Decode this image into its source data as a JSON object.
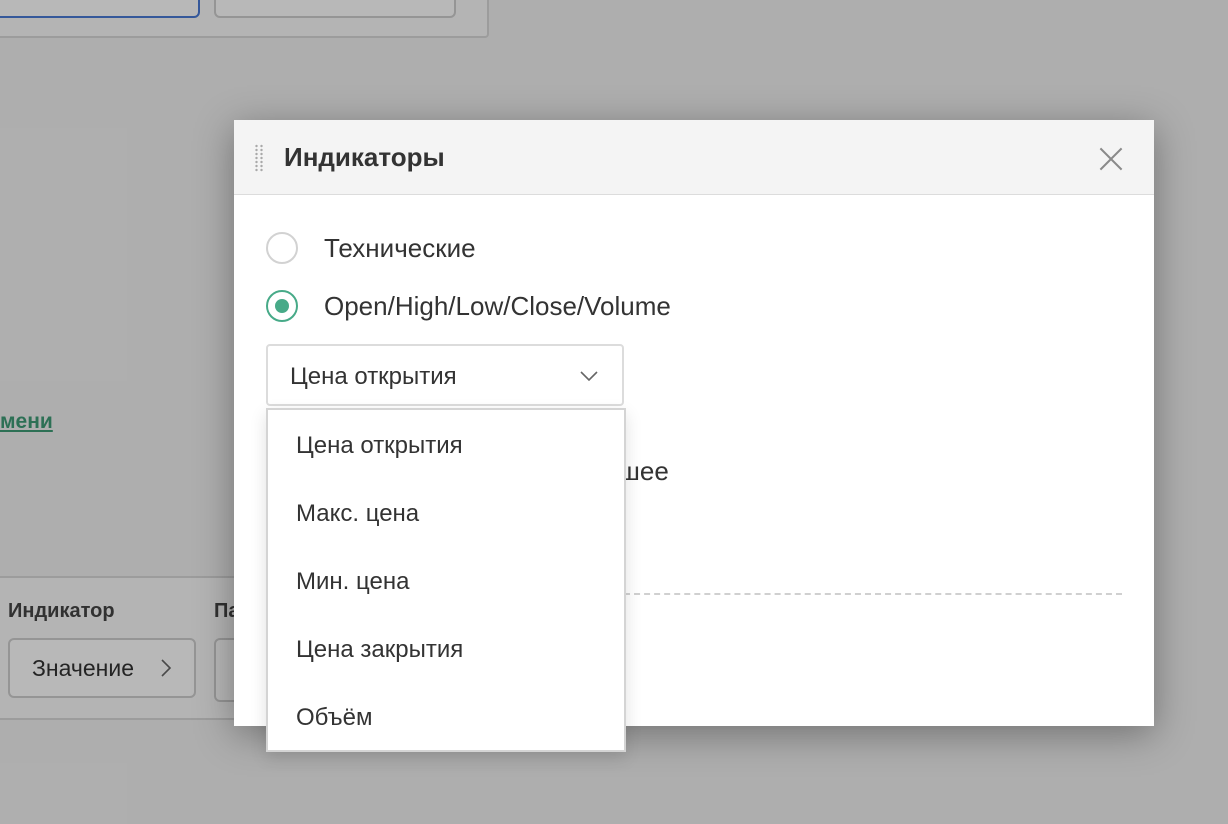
{
  "background": {
    "link_text": "мени",
    "column_label_1": "Индикатор",
    "column_label_2": "Па",
    "value_button_label": "Значение",
    "link_color": "#3f9c77"
  },
  "modal": {
    "title": "Индикаторы",
    "close_icon": "close-icon",
    "radio_options": [
      {
        "label": "Технические",
        "checked": false
      },
      {
        "label": "Open/High/Low/Close/Volume",
        "checked": true
      }
    ],
    "select": {
      "value": "Цена открытия",
      "icon": "chevron-down-icon"
    },
    "partial_text": "шее",
    "accent_color": "#47aa88"
  },
  "dropdown": {
    "options": [
      "Цена открытия",
      "Макс. цена",
      "Мин. цена",
      "Цена закрытия",
      "Объём"
    ]
  }
}
